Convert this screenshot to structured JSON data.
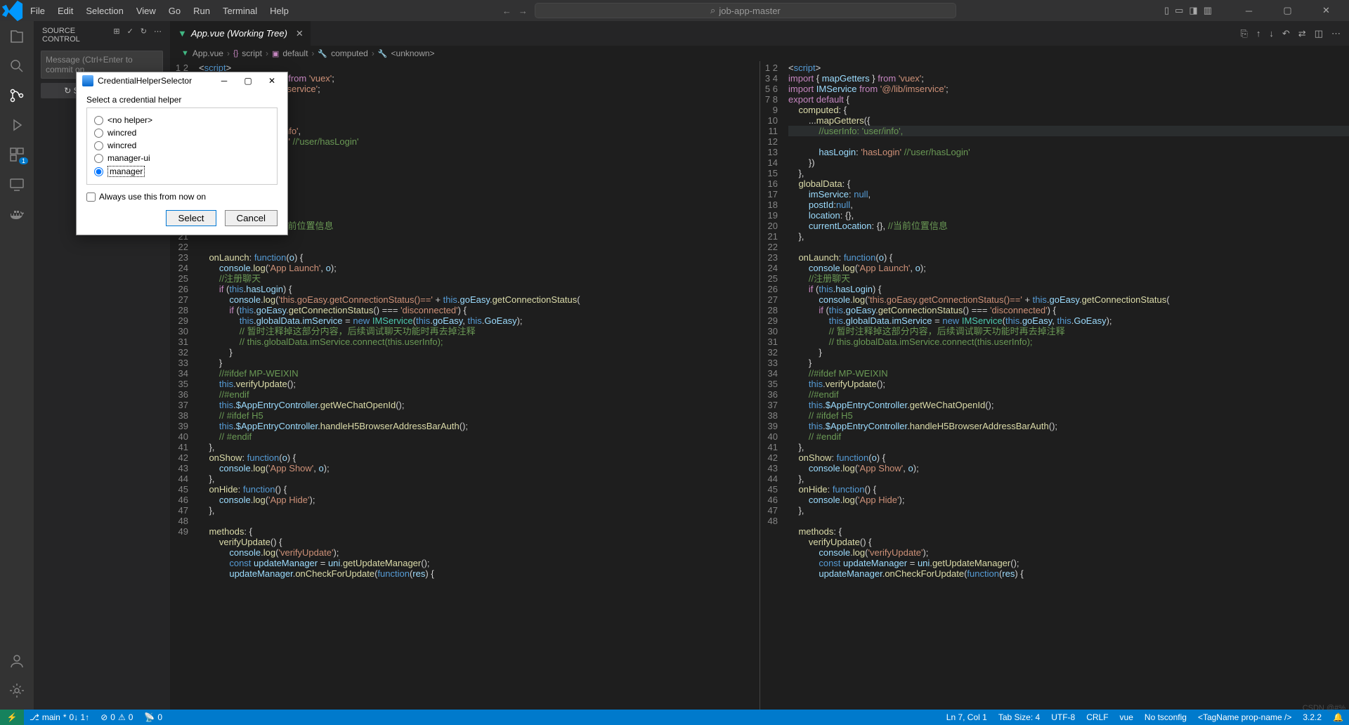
{
  "menu": [
    "File",
    "Edit",
    "Selection",
    "View",
    "Go",
    "Run",
    "Terminal",
    "Help"
  ],
  "title_search": "job-app-master",
  "sidebar": {
    "title": "SOURCE CONTROL",
    "commit_placeholder": "Message (Ctrl+Enter to commit on...",
    "sync_label": "Sync Changes 1↑"
  },
  "tab": {
    "name": "App.vue (Working Tree)"
  },
  "breadcrumb": [
    "App.vue",
    "script",
    "default",
    "computed",
    "<unknown>"
  ],
  "breadcrumb_icons": [
    "vue",
    "braces",
    "cube",
    "wrench",
    "wrench"
  ],
  "modal": {
    "title": "CredentialHelperSelector",
    "prompt": "Select a credential helper",
    "options": [
      "<no helper>",
      "wincred",
      "wincred",
      "manager-ui",
      "manager"
    ],
    "selected": 4,
    "always": "Always use this from now on",
    "select": "Select",
    "cancel": "Cancel"
  },
  "status": {
    "branch": "main",
    "sync": "0↓ 1↑",
    "errors": "0",
    "warnings": "0",
    "ports": "0",
    "ln": "Ln 7, Col 1",
    "tab": "Tab Size: 4",
    "enc": "UTF-8",
    "eol": "CRLF",
    "lang": "vue",
    "ts": "No tsconfig",
    "tag": "<TagName prop-name />",
    "ver": "3.2.2"
  },
  "code": {
    "left_start": 1,
    "right_start": 1,
    "right_highlight": 7,
    "left_lines": [
      "<span class='tok-p'>&lt;</span><span class='tok-n'>script</span><span class='tok-p'>&gt;</span>",
      "<span class='tok-k'>import</span> <span class='tok-p'>{</span> <span class='tok-v'>mapGetters</span> <span class='tok-p'>}</span> <span class='tok-k'>from</span> <span class='tok-s'>'vuex'</span><span class='tok-p'>;</span>",
      "                     <span class='tok-s'>'@/lib/imservice'</span><span class='tok-p'>;</span>",
      "",
      "",
      "                    <span class='tok-p'>({</span>",
      "                    <span class='tok-v'>o</span>: <span class='tok-s'>'user/info'</span>,",
      "                    <span class='tok-s'>'hasLogin'</span> <span class='tok-c'>//'user/hasLogin'</span>",
      "",
      "",
      "",
      "",
      "                    <span class='tok-v'>ll</span>,",
      "",
      "",
      "                   <span class='tok-v'>on</span>: <span class='tok-p'>{},</span> <span class='tok-c'>//当前位置信息</span>",
      "",
      "",
      "    <span class='tok-f'>onLaunch</span>: <span class='tok-n'>function</span>(<span class='tok-v'>o</span>) <span class='tok-p'>{</span>",
      "        <span class='tok-v'>console</span>.<span class='tok-f'>log</span>(<span class='tok-s'>'App Launch'</span>, <span class='tok-v'>o</span>);",
      "        <span class='tok-c'>//注册聊天</span>",
      "        <span class='tok-k'>if</span> (<span class='tok-n'>this</span>.<span class='tok-v'>hasLogin</span>) <span class='tok-p'>{</span>",
      "            <span class='tok-v'>console</span>.<span class='tok-f'>log</span>(<span class='tok-s'>'this.goEasy.getConnectionStatus()=='</span> + <span class='tok-n'>this</span>.<span class='tok-v'>goEasy</span>.<span class='tok-f'>getConnectionStatus</span>(",
      "            <span class='tok-k'>if</span> (<span class='tok-n'>this</span>.<span class='tok-v'>goEasy</span>.<span class='tok-f'>getConnectionStatus</span>() === <span class='tok-s'>'disconnected'</span>) <span class='tok-p'>{</span>",
      "                <span class='tok-n'>this</span>.<span class='tok-v'>globalData</span>.<span class='tok-v'>imService</span> = <span class='tok-n'>new</span> <span class='tok-t'>IMService</span>(<span class='tok-n'>this</span>.<span class='tok-v'>goEasy</span>, <span class='tok-n'>this</span>.<span class='tok-v'>GoEasy</span>);",
      "                <span class='tok-c'>// 暂时注释掉这部分内容，后续调试聊天功能时再去掉注释</span>",
      "                <span class='tok-c'>// this.globalData.imService.connect(this.userInfo);</span>",
      "            <span class='tok-p'>}</span>",
      "        <span class='tok-p'>}</span>",
      "        <span class='tok-c'>//#ifdef MP-WEIXIN</span>",
      "        <span class='tok-n'>this</span>.<span class='tok-f'>verifyUpdate</span>();",
      "        <span class='tok-c'>//#endif</span>",
      "        <span class='tok-n'>this</span>.<span class='tok-v'>$AppEntryController</span>.<span class='tok-f'>getWeChatOpenId</span>();",
      "        <span class='tok-c'>// #ifdef H5</span>",
      "        <span class='tok-n'>this</span>.<span class='tok-v'>$AppEntryController</span>.<span class='tok-f'>handleH5BrowserAddressBarAuth</span>();",
      "        <span class='tok-c'>// #endif</span>",
      "    <span class='tok-p'>},</span>",
      "    <span class='tok-f'>onShow</span>: <span class='tok-n'>function</span>(<span class='tok-v'>o</span>) <span class='tok-p'>{</span>",
      "        <span class='tok-v'>console</span>.<span class='tok-f'>log</span>(<span class='tok-s'>'App Show'</span>, <span class='tok-v'>o</span>);",
      "    <span class='tok-p'>},</span>",
      "    <span class='tok-f'>onHide</span>: <span class='tok-n'>function</span>() <span class='tok-p'>{</span>",
      "        <span class='tok-v'>console</span>.<span class='tok-f'>log</span>(<span class='tok-s'>'App Hide'</span>);",
      "    <span class='tok-p'>},</span>",
      "",
      "    <span class='tok-f'>methods</span>: <span class='tok-p'>{</span>",
      "        <span class='tok-f'>verifyUpdate</span>() <span class='tok-p'>{</span>",
      "            <span class='tok-v'>console</span>.<span class='tok-f'>log</span>(<span class='tok-s'>'verifyUpdate'</span>);",
      "            <span class='tok-n'>const</span> <span class='tok-v'>updateManager</span> = <span class='tok-v'>uni</span>.<span class='tok-f'>getUpdateManager</span>();",
      "            <span class='tok-v'>updateManager</span>.<span class='tok-f'>onCheckForUpdate</span>(<span class='tok-n'>function</span>(<span class='tok-v'>res</span>) <span class='tok-p'>{</span>"
    ],
    "right_lines": [
      "<span class='tok-p'>&lt;</span><span class='tok-n'>script</span><span class='tok-p'>&gt;</span>",
      "<span class='tok-k'>import</span> <span class='tok-p'>{</span> <span class='tok-v'>mapGetters</span> <span class='tok-p'>}</span> <span class='tok-k'>from</span> <span class='tok-s'>'vuex'</span><span class='tok-p'>;</span>",
      "<span class='tok-k'>import</span> <span class='tok-v'>IMService</span> <span class='tok-k'>from</span> <span class='tok-s'>'@/lib/imservice'</span><span class='tok-p'>;</span>",
      "<span class='tok-k'>export</span> <span class='tok-k'>default</span> <span class='tok-p'>{</span>",
      "    <span class='tok-f'>computed</span>: <span class='tok-p'>{</span>",
      "        ...<span class='tok-f'>mapGetters</span>(<span class='tok-p'>{</span>",
      "            <span class='tok-c'>//userInfo: 'user/info',</span>",
      "            <span class='tok-v'>hasLogin</span>: <span class='tok-s'>'hasLogin'</span> <span class='tok-c'>//'user/hasLogin'</span>",
      "        <span class='tok-p'>})</span>",
      "    <span class='tok-p'>},</span>",
      "    <span class='tok-f'>globalData</span>: <span class='tok-p'>{</span>",
      "        <span class='tok-v'>imService</span>: <span class='tok-n'>null</span>,",
      "        <span class='tok-v'>postId</span>:<span class='tok-n'>null</span>,",
      "        <span class='tok-v'>location</span>: <span class='tok-p'>{},</span>",
      "        <span class='tok-v'>currentLocation</span>: <span class='tok-p'>{},</span> <span class='tok-c'>//当前位置信息</span>",
      "    <span class='tok-p'>},</span>",
      "",
      "    <span class='tok-f'>onLaunch</span>: <span class='tok-n'>function</span>(<span class='tok-v'>o</span>) <span class='tok-p'>{</span>",
      "        <span class='tok-v'>console</span>.<span class='tok-f'>log</span>(<span class='tok-s'>'App Launch'</span>, <span class='tok-v'>o</span>);",
      "        <span class='tok-c'>//注册聊天</span>",
      "        <span class='tok-k'>if</span> (<span class='tok-n'>this</span>.<span class='tok-v'>hasLogin</span>) <span class='tok-p'>{</span>",
      "            <span class='tok-v'>console</span>.<span class='tok-f'>log</span>(<span class='tok-s'>'this.goEasy.getConnectionStatus()=='</span> + <span class='tok-n'>this</span>.<span class='tok-v'>goEasy</span>.<span class='tok-f'>getConnectionStatus</span>(",
      "            <span class='tok-k'>if</span> (<span class='tok-n'>this</span>.<span class='tok-v'>goEasy</span>.<span class='tok-f'>getConnectionStatus</span>() === <span class='tok-s'>'disconnected'</span>) <span class='tok-p'>{</span>",
      "                <span class='tok-n'>this</span>.<span class='tok-v'>globalData</span>.<span class='tok-v'>imService</span> = <span class='tok-n'>new</span> <span class='tok-t'>IMService</span>(<span class='tok-n'>this</span>.<span class='tok-v'>goEasy</span>, <span class='tok-n'>this</span>.<span class='tok-v'>GoEasy</span>);",
      "                <span class='tok-c'>// 暂时注释掉这部分内容，后续调试聊天功能时再去掉注释</span>",
      "                <span class='tok-c'>// this.globalData.imService.connect(this.userInfo);</span>",
      "            <span class='tok-p'>}</span>",
      "        <span class='tok-p'>}</span>",
      "        <span class='tok-c'>//#ifdef MP-WEIXIN</span>",
      "        <span class='tok-n'>this</span>.<span class='tok-f'>verifyUpdate</span>();",
      "        <span class='tok-c'>//#endif</span>",
      "        <span class='tok-n'>this</span>.<span class='tok-v'>$AppEntryController</span>.<span class='tok-f'>getWeChatOpenId</span>();",
      "        <span class='tok-c'>// #ifdef H5</span>",
      "        <span class='tok-n'>this</span>.<span class='tok-v'>$AppEntryController</span>.<span class='tok-f'>handleH5BrowserAddressBarAuth</span>();",
      "        <span class='tok-c'>// #endif</span>",
      "    <span class='tok-p'>},</span>",
      "    <span class='tok-f'>onShow</span>: <span class='tok-n'>function</span>(<span class='tok-v'>o</span>) <span class='tok-p'>{</span>",
      "        <span class='tok-v'>console</span>.<span class='tok-f'>log</span>(<span class='tok-s'>'App Show'</span>, <span class='tok-v'>o</span>);",
      "    <span class='tok-p'>},</span>",
      "    <span class='tok-f'>onHide</span>: <span class='tok-n'>function</span>() <span class='tok-p'>{</span>",
      "        <span class='tok-v'>console</span>.<span class='tok-f'>log</span>(<span class='tok-s'>'App Hide'</span>);",
      "    <span class='tok-p'>},</span>",
      "",
      "    <span class='tok-f'>methods</span>: <span class='tok-p'>{</span>",
      "        <span class='tok-f'>verifyUpdate</span>() <span class='tok-p'>{</span>",
      "            <span class='tok-v'>console</span>.<span class='tok-f'>log</span>(<span class='tok-s'>'verifyUpdate'</span>);",
      "            <span class='tok-n'>const</span> <span class='tok-v'>updateManager</span> = <span class='tok-v'>uni</span>.<span class='tok-f'>getUpdateManager</span>();",
      "            <span class='tok-v'>updateManager</span>.<span class='tok-f'>onCheckForUpdate</span>(<span class='tok-n'>function</span>(<span class='tok-v'>res</span>) <span class='tok-p'>{</span>"
    ]
  },
  "watermark": "CSDN @#%"
}
